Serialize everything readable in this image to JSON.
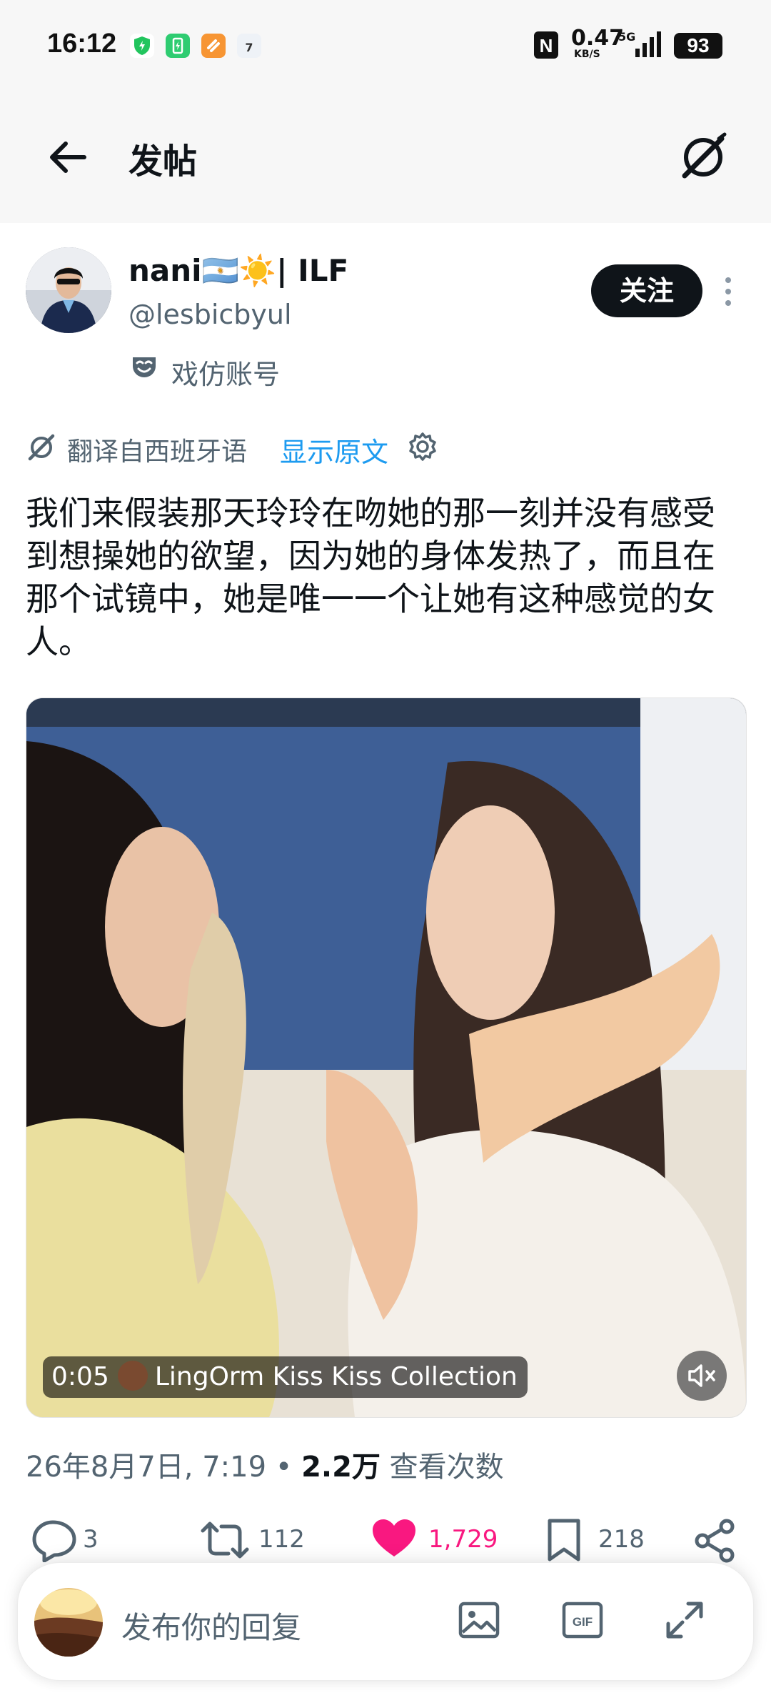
{
  "status_bar": {
    "time": "16:12",
    "net_speed": "0.47",
    "net_unit": "KB/S",
    "network": "5G",
    "battery": "93",
    "nfc": "N",
    "calendar_day": "7"
  },
  "header": {
    "title": "发帖"
  },
  "author": {
    "name": "nani🇦🇷☀️| ILF",
    "handle": "@lesbicbyul",
    "follow_label": "关注",
    "parody_label": "戏仿账号"
  },
  "translation": {
    "label": "翻译自西班牙语",
    "show_original": "显示原文"
  },
  "tweet": {
    "text": "我们来假装那天玲玲在吻她的那一刻并没有感受到想操她的欲望，因为她的身体发热了，而且在那个试镜中，她是唯一一个让她有这种感觉的女人。"
  },
  "media": {
    "time": "0:05",
    "title": "LingOrm Kiss Kiss Collection"
  },
  "meta": {
    "date": "26年8月7日, 7:19",
    "separator": "•",
    "views": "2.2万",
    "views_label": "查看次数"
  },
  "actions": {
    "replies": "3",
    "reposts": "112",
    "likes": "1,729",
    "bookmarks": "218"
  },
  "composer": {
    "placeholder": "发布你的回复",
    "gif_label": "GIF"
  },
  "colors": {
    "accent": "#1d9bf0",
    "like": "#f91880",
    "text": "#0f1419",
    "secondary": "#536471"
  }
}
